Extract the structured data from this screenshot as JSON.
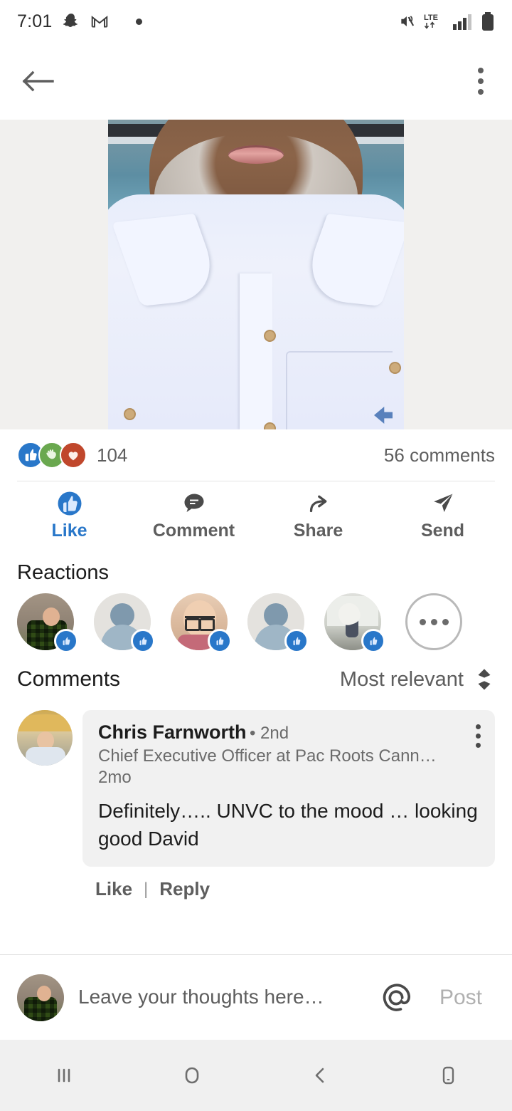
{
  "status_bar": {
    "time": "7:01",
    "icons": [
      "snapchat-icon",
      "gmail-icon",
      "notification-dot",
      "mute-icon",
      "lte-icon",
      "signal-icon",
      "battery-icon"
    ],
    "network": "LTE"
  },
  "app_bar": {
    "back": "back-arrow-icon",
    "overflow": "overflow-menu-icon"
  },
  "post": {
    "media_alt": "post-photo"
  },
  "social": {
    "reaction_icons": [
      "like-reaction",
      "celebrate-reaction",
      "love-reaction"
    ],
    "reaction_count": "104",
    "comments_count": "56 comments"
  },
  "actions": [
    {
      "label": "Like",
      "icon": "thumbs-up-icon",
      "active": true
    },
    {
      "label": "Comment",
      "icon": "comment-bubble-icon",
      "active": false
    },
    {
      "label": "Share",
      "icon": "share-arrow-icon",
      "active": false
    },
    {
      "label": "Send",
      "icon": "send-paper-plane-icon",
      "active": false
    }
  ],
  "reactions": {
    "title": "Reactions",
    "avatars": [
      {
        "name": "reactor-avatar-1",
        "style": "plaid",
        "badge": "like-reaction"
      },
      {
        "name": "reactor-avatar-2",
        "style": "default",
        "badge": "like-reaction"
      },
      {
        "name": "reactor-avatar-3",
        "style": "glasses",
        "badge": "like-reaction"
      },
      {
        "name": "reactor-avatar-4",
        "style": "default",
        "badge": "like-reaction"
      },
      {
        "name": "reactor-avatar-5",
        "style": "couple",
        "badge": "like-reaction"
      }
    ],
    "more_label": "more-reactions"
  },
  "comments_section": {
    "title": "Comments",
    "sort_label": "Most relevant",
    "sort_icon": "sort-chevron-icon",
    "items": [
      {
        "author": "Chris Farnworth",
        "degree": "• 2nd",
        "headline": "Chief Executive Officer at Pac Roots Canna…",
        "time": "2mo",
        "body": "Definitely….. UNVC to the mood … looking good David",
        "like_label": "Like",
        "separator": "|",
        "reply_label": "Reply"
      }
    ]
  },
  "composer": {
    "placeholder": "Leave your thoughts here…",
    "mention_icon": "at-mention-icon",
    "post_label": "Post"
  },
  "nav_bar": {
    "items": [
      "recents-icon",
      "home-icon",
      "back-icon",
      "phone-icon"
    ]
  },
  "colors": {
    "accent": "#2977c9",
    "text_primary": "#1c1c1c",
    "text_secondary": "#5e5e5e",
    "bubble_bg": "#f1f1f1",
    "media_letterbox": "#f1f0ee"
  }
}
